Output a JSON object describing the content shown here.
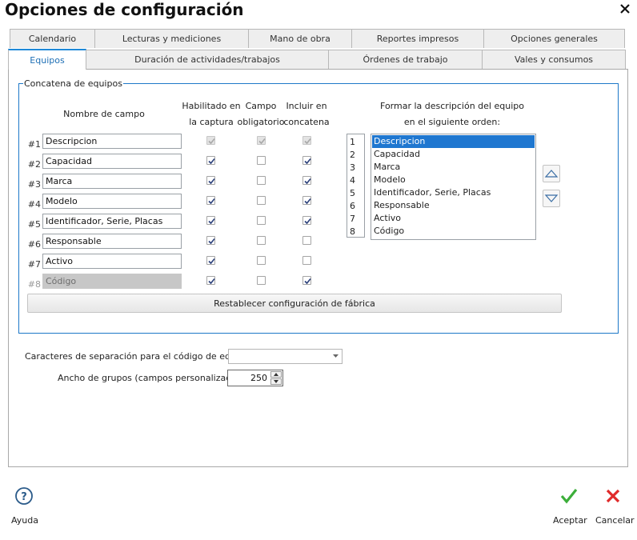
{
  "window": {
    "title": "Opciones de configuración"
  },
  "tabs_row1": [
    {
      "label": "Calendario"
    },
    {
      "label": "Lecturas y mediciones"
    },
    {
      "label": "Mano de obra"
    },
    {
      "label": "Reportes impresos"
    },
    {
      "label": "Opciones generales"
    }
  ],
  "tabs_row2": [
    {
      "label": "Equipos",
      "active": true
    },
    {
      "label": "Duración de actividades/trabajos"
    },
    {
      "label": "Órdenes de trabajo"
    },
    {
      "label": "Vales y consumos"
    }
  ],
  "group": {
    "legend": "Concatena de equipos"
  },
  "headers": {
    "field_name": "Nombre de campo",
    "enabled_1": "Habilitado en",
    "enabled_2": "la captura",
    "required_1": "Campo",
    "required_2": "obligatorio",
    "include_1": "Incluir en",
    "include_2": "concatena",
    "order_1": "Formar la descripción del equipo",
    "order_2": "en el siguiente orden:"
  },
  "rows": [
    {
      "num": "#1",
      "value": "Descripcion",
      "enabled": true,
      "required": true,
      "include": true,
      "enabled_dis": true,
      "required_dis": true,
      "include_dis": true,
      "field_dis": false
    },
    {
      "num": "#2",
      "value": "Capacidad",
      "enabled": true,
      "required": false,
      "include": true,
      "enabled_dis": false,
      "required_dis": false,
      "include_dis": false,
      "field_dis": false
    },
    {
      "num": "#3",
      "value": "Marca",
      "enabled": true,
      "required": false,
      "include": true,
      "enabled_dis": false,
      "required_dis": false,
      "include_dis": false,
      "field_dis": false
    },
    {
      "num": "#4",
      "value": "Modelo",
      "enabled": true,
      "required": false,
      "include": true,
      "enabled_dis": false,
      "required_dis": false,
      "include_dis": false,
      "field_dis": false
    },
    {
      "num": "#5",
      "value": "Identificador, Serie, Placas",
      "enabled": true,
      "required": false,
      "include": true,
      "enabled_dis": false,
      "required_dis": false,
      "include_dis": false,
      "field_dis": false
    },
    {
      "num": "#6",
      "value": "Responsable",
      "enabled": true,
      "required": false,
      "include": false,
      "enabled_dis": false,
      "required_dis": false,
      "include_dis": false,
      "field_dis": false
    },
    {
      "num": "#7",
      "value": "Activo",
      "enabled": true,
      "required": false,
      "include": false,
      "enabled_dis": false,
      "required_dis": false,
      "include_dis": false,
      "field_dis": false
    },
    {
      "num": "#8",
      "value": "Código",
      "enabled": true,
      "required": false,
      "include": true,
      "enabled_dis": false,
      "required_dis": false,
      "include_dis": false,
      "field_dis": true
    }
  ],
  "order": {
    "numbers": [
      "1",
      "2",
      "3",
      "4",
      "5",
      "6",
      "7",
      "8"
    ],
    "items": [
      "Descripcion",
      "Capacidad",
      "Marca",
      "Modelo",
      "Identificador, Serie, Placas",
      "Responsable",
      "Activo",
      "Código"
    ],
    "selected_index": 0
  },
  "reset_button": "Restablecer configuración de fábrica",
  "separator": {
    "label": "Caracteres de separación para el código de equipo:",
    "value": ""
  },
  "group_width": {
    "label": "Ancho de grupos (campos personalizados):",
    "value": "250"
  },
  "footer": {
    "help_label": "Ayuda",
    "accept_label": "Aceptar",
    "cancel_label": "Cancelar"
  },
  "icons": {
    "close": "close-icon",
    "help": "help-icon",
    "accept": "checkmark-icon",
    "cancel": "cancel-x-icon",
    "up": "triangle-up-icon",
    "down": "triangle-down-icon"
  },
  "colors": {
    "accent": "#1e78c8",
    "selection": "#1f77d0",
    "accept": "#3cae3a",
    "cancel": "#e02a2a"
  }
}
